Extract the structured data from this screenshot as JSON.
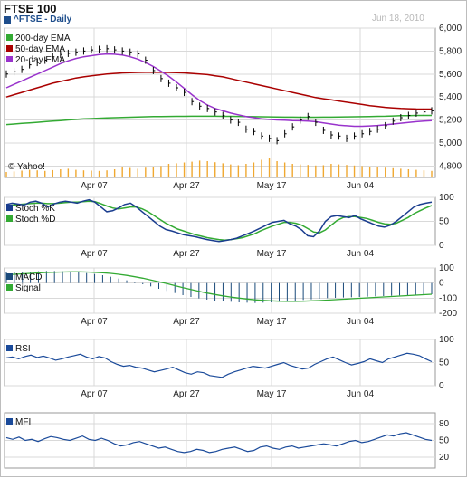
{
  "header": {
    "title": "FTSE 100",
    "subtitle": "^FTSE - Daily",
    "date": "Jun 18, 2010",
    "watermark": "© Yahoo!"
  },
  "colors": {
    "ema200": "#33aa33",
    "ema50": "#aa0000",
    "ema20": "#9933cc",
    "price": "#000000",
    "volume": "#f0a830",
    "stoch_k": "#1a3d8f",
    "stoch_d": "#33aa33",
    "macd": "#1a4a7a",
    "signal": "#33aa33",
    "rsi": "#1a4a9a",
    "mfi": "#1a4a9a",
    "subtitle_swatch": "#1f4e8c"
  },
  "x_labels": [
    "Apr 07",
    "Apr 27",
    "May 17",
    "Jun 04"
  ],
  "chart_data": [
    {
      "type": "line",
      "panel": "price",
      "ylim": [
        4700,
        6000
      ],
      "y_ticks": [
        "6,000",
        "5,800",
        "5,600",
        "5,400",
        "5,200",
        "5,000",
        "4,800"
      ],
      "legend": [
        "200-day EMA",
        "50-day EMA",
        "20-day EMA"
      ],
      "series": [
        {
          "name": "200-day EMA",
          "values": [
            5160,
            5165,
            5170,
            5175,
            5180,
            5185,
            5190,
            5195,
            5200,
            5205,
            5210,
            5212,
            5215,
            5218,
            5220,
            5222,
            5224,
            5226,
            5228,
            5230,
            5230,
            5231,
            5232,
            5232,
            5233,
            5233,
            5233,
            5233,
            5232,
            5232,
            5231,
            5230,
            5229,
            5228,
            5227,
            5226,
            5225,
            5225,
            5224,
            5224,
            5224,
            5225,
            5225,
            5226,
            5227,
            5228,
            5229,
            5230,
            5232,
            5233,
            5235,
            5237,
            5238,
            5240,
            5240,
            5240
          ]
        },
        {
          "name": "50-day EMA",
          "values": [
            5400,
            5420,
            5440,
            5460,
            5480,
            5500,
            5520,
            5535,
            5550,
            5565,
            5575,
            5585,
            5592,
            5600,
            5605,
            5610,
            5612,
            5614,
            5615,
            5615,
            5615,
            5614,
            5612,
            5610,
            5605,
            5600,
            5595,
            5585,
            5575,
            5560,
            5545,
            5530,
            5515,
            5500,
            5485,
            5470,
            5455,
            5440,
            5425,
            5410,
            5395,
            5385,
            5375,
            5365,
            5355,
            5345,
            5335,
            5325,
            5318,
            5310,
            5305,
            5300,
            5298,
            5296,
            5295,
            5295
          ]
        },
        {
          "name": "20-day EMA",
          "values": [
            5480,
            5510,
            5540,
            5570,
            5600,
            5630,
            5660,
            5690,
            5715,
            5735,
            5750,
            5760,
            5770,
            5775,
            5772,
            5765,
            5750,
            5730,
            5700,
            5665,
            5625,
            5580,
            5530,
            5475,
            5420,
            5370,
            5330,
            5300,
            5280,
            5260,
            5245,
            5230,
            5220,
            5210,
            5205,
            5200,
            5198,
            5195,
            5193,
            5190,
            5185,
            5175,
            5165,
            5155,
            5150,
            5145,
            5145,
            5148,
            5152,
            5158,
            5165,
            5172,
            5178,
            5185,
            5190,
            5195
          ]
        }
      ],
      "ohlc_close": [
        5600,
        5620,
        5640,
        5680,
        5700,
        5720,
        5750,
        5770,
        5780,
        5790,
        5800,
        5810,
        5815,
        5820,
        5810,
        5800,
        5790,
        5775,
        5720,
        5630,
        5560,
        5520,
        5480,
        5440,
        5360,
        5320,
        5300,
        5270,
        5240,
        5200,
        5180,
        5120,
        5100,
        5060,
        5040,
        5020,
        5080,
        5140,
        5200,
        5230,
        5180,
        5110,
        5070,
        5060,
        5040,
        5060,
        5080,
        5100,
        5120,
        5150,
        5190,
        5220,
        5240,
        5260,
        5270,
        5280
      ]
    },
    {
      "type": "bar",
      "panel": "volume",
      "values": [
        20,
        22,
        25,
        28,
        26,
        24,
        27,
        30,
        32,
        28,
        26,
        25,
        24,
        26,
        30,
        38,
        35,
        32,
        36,
        40,
        42,
        50,
        52,
        55,
        58,
        62,
        60,
        56,
        52,
        48,
        45,
        50,
        55,
        65,
        70,
        60,
        55,
        50,
        48,
        46,
        44,
        45,
        50,
        48,
        46,
        44,
        42,
        40,
        38,
        36,
        34,
        32,
        30,
        28,
        26,
        24
      ]
    },
    {
      "type": "line",
      "panel": "stochastic",
      "ylim": [
        0,
        100
      ],
      "y_ticks": [
        "100",
        "50",
        "0"
      ],
      "legend": [
        "Stoch %K",
        "Stoch %D"
      ],
      "series": [
        {
          "name": "Stoch %K",
          "values": [
            85,
            88,
            86,
            84,
            90,
            92,
            88,
            80,
            86,
            90,
            92,
            90,
            88,
            92,
            95,
            90,
            80,
            70,
            72,
            78,
            85,
            88,
            80,
            70,
            60,
            50,
            40,
            33,
            30,
            26,
            22,
            20,
            18,
            15,
            12,
            10,
            8,
            10,
            12,
            15,
            20,
            25,
            30,
            36,
            42,
            48,
            50,
            52,
            45,
            40,
            32,
            20,
            18,
            30,
            50,
            60,
            62,
            60,
            58,
            62,
            55,
            50,
            45,
            40,
            38,
            42,
            50,
            60,
            70,
            80,
            85,
            88,
            90
          ]
        },
        {
          "name": "Stoch %D",
          "values": [
            82,
            84,
            85,
            86,
            87,
            88,
            88,
            87,
            87,
            88,
            89,
            90,
            90,
            91,
            92,
            91,
            87,
            82,
            78,
            76,
            78,
            80,
            80,
            76,
            70,
            62,
            54,
            46,
            40,
            34,
            30,
            26,
            22,
            19,
            16,
            14,
            12,
            11,
            12,
            14,
            16,
            20,
            24,
            30,
            35,
            40,
            44,
            48,
            48,
            46,
            42,
            35,
            28,
            26,
            32,
            42,
            52,
            58,
            60,
            60,
            58,
            56,
            52,
            48,
            45,
            44,
            46,
            52,
            58,
            66,
            72,
            78,
            83
          ]
        }
      ]
    },
    {
      "type": "bar",
      "panel": "macd",
      "ylim": [
        -200,
        100
      ],
      "y_ticks": [
        "100",
        "0",
        "-100",
        "-200"
      ],
      "legend": [
        "MACD",
        "Signal"
      ],
      "series": [
        {
          "name": "MACD",
          "values": [
            70,
            72,
            74,
            76,
            78,
            80,
            80,
            78,
            76,
            72,
            66,
            60,
            52,
            42,
            30,
            18,
            5,
            -8,
            -22,
            -38,
            -52,
            -66,
            -80,
            -92,
            -102,
            -110,
            -116,
            -120,
            -124,
            -128,
            -130,
            -132,
            -130,
            -128,
            -124,
            -120,
            -116,
            -112,
            -108,
            -104,
            -100,
            -98,
            -96,
            -94,
            -92,
            -90,
            -88,
            -86,
            -84,
            -82,
            -80,
            -78,
            -76,
            -74
          ]
        },
        {
          "name": "Signal",
          "values": [
            55,
            58,
            61,
            64,
            67,
            70,
            72,
            73,
            74,
            74,
            73,
            71,
            68,
            64,
            58,
            51,
            42,
            32,
            21,
            9,
            -4,
            -17,
            -30,
            -43,
            -55,
            -66,
            -76,
            -85,
            -93,
            -100,
            -106,
            -111,
            -115,
            -118,
            -120,
            -121,
            -121,
            -120,
            -118,
            -116,
            -113,
            -110,
            -107,
            -104,
            -101,
            -98,
            -95,
            -92,
            -89,
            -86,
            -83,
            -80,
            -77,
            -74
          ]
        }
      ]
    },
    {
      "type": "line",
      "panel": "rsi",
      "ylim": [
        0,
        100
      ],
      "y_ticks": [
        "100",
        "50",
        "0"
      ],
      "legend": [
        "RSI"
      ],
      "series": [
        {
          "name": "RSI",
          "values": [
            60,
            62,
            58,
            63,
            66,
            61,
            64,
            60,
            55,
            58,
            62,
            65,
            68,
            62,
            58,
            63,
            60,
            52,
            46,
            42,
            44,
            40,
            38,
            34,
            30,
            33,
            36,
            40,
            34,
            28,
            25,
            30,
            28,
            22,
            20,
            18,
            25,
            30,
            34,
            38,
            42,
            40,
            38,
            42,
            46,
            50,
            44,
            40,
            36,
            38,
            46,
            52,
            58,
            62,
            56,
            50,
            45,
            48,
            52,
            58,
            54,
            50,
            58,
            62,
            66,
            70,
            68,
            65,
            58,
            52
          ]
        }
      ]
    },
    {
      "type": "line",
      "panel": "mfi",
      "ylim": [
        0,
        100
      ],
      "y_ticks": [
        "80",
        "50",
        "20"
      ],
      "legend": [
        "MFI"
      ],
      "series": [
        {
          "name": "MFI",
          "values": [
            55,
            52,
            56,
            50,
            52,
            48,
            53,
            57,
            55,
            52,
            50,
            54,
            58,
            52,
            50,
            54,
            50,
            44,
            40,
            42,
            46,
            48,
            44,
            40,
            36,
            38,
            34,
            30,
            28,
            30,
            34,
            32,
            28,
            30,
            34,
            36,
            38,
            34,
            30,
            32,
            38,
            40,
            36,
            34,
            38,
            40,
            36,
            38,
            40,
            42,
            44,
            42,
            40,
            44,
            48,
            50,
            46,
            48,
            52,
            56,
            60,
            58,
            62,
            64,
            60,
            56,
            52,
            50
          ]
        }
      ]
    }
  ]
}
